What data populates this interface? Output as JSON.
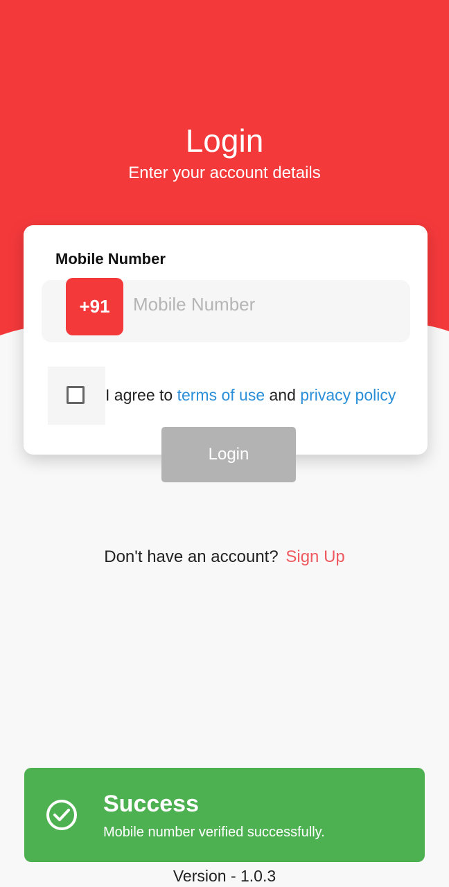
{
  "colors": {
    "primary": "#f4393b",
    "success": "#4eb151",
    "link": "#2a8fd8",
    "signup": "#ee5a5f",
    "disabled": "#b3b3b3"
  },
  "header": {
    "title": "Login",
    "subtitle": "Enter your account details"
  },
  "form": {
    "field_label": "Mobile Number",
    "country_code": "+91",
    "mobile_value": "",
    "mobile_placeholder": "Mobile Number",
    "agree_prefix": "I agree to",
    "terms_link": "terms of use",
    "agree_middle": "and",
    "privacy_link": "privacy policy",
    "checked": false,
    "login_label": "Login",
    "login_enabled": false
  },
  "signup": {
    "prompt": "Don't have an account?",
    "link": "Sign Up"
  },
  "toast": {
    "icon": "check-circle-icon",
    "title": "Success",
    "message": "Mobile number verified successfully."
  },
  "footer": {
    "version": "Version - 1.0.3"
  }
}
